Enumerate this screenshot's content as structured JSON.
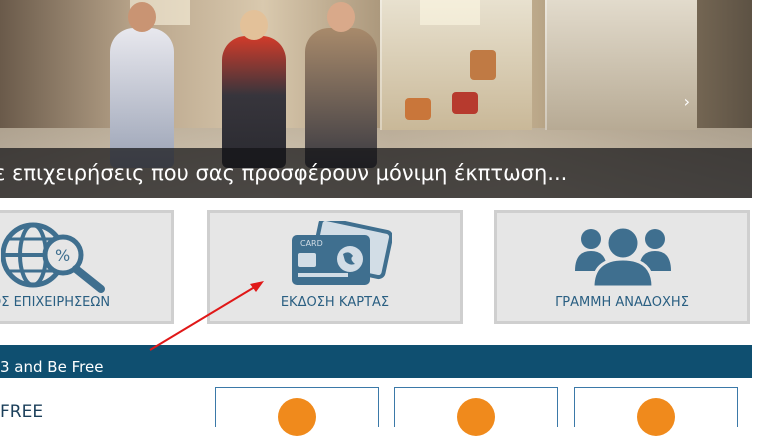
{
  "hero": {
    "caption": "ε επιχειρήσεις που σας προσφέρουν μόνιμη έκπτωση...",
    "next_arrow": "›"
  },
  "tiles": [
    {
      "label": "ΟΣ ΕΠΙΧΕΙΡΗΣΕΩΝ",
      "icon": "globe-search-icon"
    },
    {
      "label": "ΕΚΔΟΣΗ ΚΑΡΤΑΣ",
      "icon": "credit-card-icon",
      "card_text": "CARD"
    },
    {
      "label": "ΓΡΑΜΜΗ ΑΝΑΔΟΧΗΣ",
      "icon": "people-group-icon"
    }
  ],
  "bluebar": {
    "text": "3 and Be Free"
  },
  "section": {
    "title": "FREE"
  },
  "colors": {
    "accent_blue": "#0f4f70",
    "icon_blue": "#3f6f8f",
    "orange": "#f08a1c",
    "annotation_red": "#e01818"
  }
}
